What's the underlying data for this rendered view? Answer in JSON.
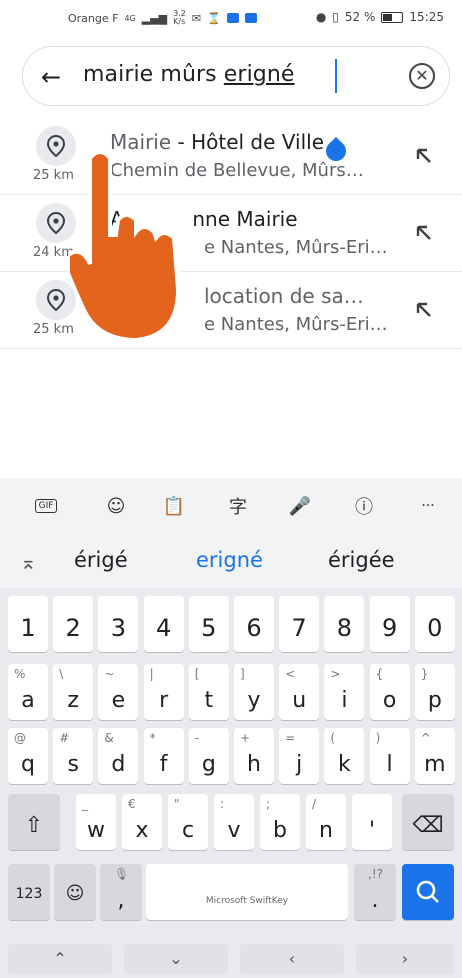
{
  "status_bar": {
    "carrier": "Orange F",
    "network": "4G",
    "speed": "3.2\nK/s",
    "battery_percent": "52 %",
    "battery_level": 0.52,
    "time": "15:25"
  },
  "search": {
    "query_prefix": "mairie mûrs ",
    "query_underlined": "erigné"
  },
  "results": [
    {
      "title_prefix": "Mairie",
      "title_rest": " - Hôtel de Ville",
      "subtitle": "Chemin de Bellevue, Mûrs…",
      "distance": "25 km"
    },
    {
      "title_prefix": "An",
      "title_rest": "nne Mairie",
      "subtitle": "e Nantes, Mûrs-Eri…",
      "distance": "24 km"
    },
    {
      "title_prefix": "",
      "title_rest": "location de sa…",
      "subtitle": "e Nantes, Mûrs-Eri…",
      "distance": "25 km"
    }
  ],
  "toolbar": {
    "gif_label": "GIF",
    "more_label": "···"
  },
  "suggestions": [
    "érigé",
    "erigné",
    "érigée"
  ],
  "keyboard": {
    "numbers": [
      "1",
      "2",
      "3",
      "4",
      "5",
      "6",
      "7",
      "8",
      "9",
      "0"
    ],
    "row1": [
      {
        "k": "a",
        "h": "%"
      },
      {
        "k": "z",
        "h": "\\"
      },
      {
        "k": "e",
        "h": "~"
      },
      {
        "k": "r",
        "h": "|"
      },
      {
        "k": "t",
        "h": "["
      },
      {
        "k": "y",
        "h": "]"
      },
      {
        "k": "u",
        "h": "<"
      },
      {
        "k": "i",
        "h": ">"
      },
      {
        "k": "o",
        "h": "{"
      },
      {
        "k": "p",
        "h": "}"
      }
    ],
    "row2": [
      {
        "k": "q",
        "h": "@"
      },
      {
        "k": "s",
        "h": "#"
      },
      {
        "k": "d",
        "h": "&"
      },
      {
        "k": "f",
        "h": "*"
      },
      {
        "k": "g",
        "h": "-"
      },
      {
        "k": "h",
        "h": "+"
      },
      {
        "k": "j",
        "h": "="
      },
      {
        "k": "k",
        "h": "("
      },
      {
        "k": "l",
        "h": ")"
      },
      {
        "k": "m",
        "h": "^"
      }
    ],
    "row3": [
      {
        "k": "w",
        "h": "_"
      },
      {
        "k": "x",
        "h": "€"
      },
      {
        "k": "c",
        "h": "\""
      },
      {
        "k": "v",
        "h": ":"
      },
      {
        "k": "b",
        "h": ";"
      },
      {
        "k": "n",
        "h": "/"
      },
      {
        "k": "'",
        "h": ""
      }
    ],
    "numbers_key": "123",
    "comma_key": ",",
    "period_key": ".",
    "period_hint": ",!?",
    "space_label": "Microsoft SwiftKey"
  }
}
